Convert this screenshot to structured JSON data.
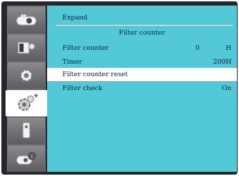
{
  "header": {
    "title": "Expand"
  },
  "section": {
    "title": "Filter counter"
  },
  "rows": [
    {
      "label": "Filter counter",
      "value": "0",
      "unit": "H"
    },
    {
      "label": "Timer",
      "value": "200H"
    },
    {
      "label": "Filter counter reset"
    },
    {
      "label": "Filter check",
      "value": "On"
    }
  ],
  "sidebar": {
    "icons": [
      "projector-icon",
      "image-adjust-icon",
      "settings-gear-icon",
      "expand-settings-icon",
      "usb-icon",
      "info-icon"
    ],
    "active_index": 3
  },
  "colors": {
    "panel": "#53c8d6",
    "frame": "#27272b",
    "selected": "#ffffff"
  }
}
